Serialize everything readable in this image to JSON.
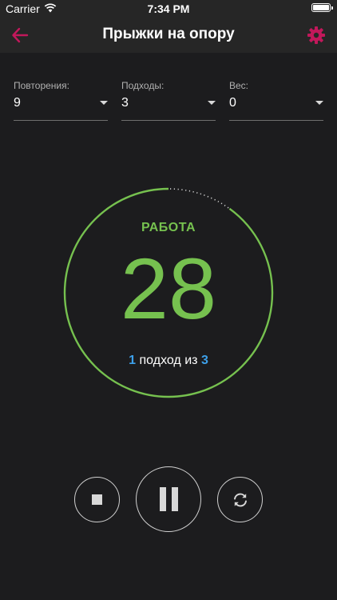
{
  "status_bar": {
    "carrier": "Carrier",
    "time": "7:34 PM",
    "battery_level": 1.0
  },
  "header": {
    "title": "Прыжки на опору",
    "back_icon": "arrow-left-icon",
    "settings_icon": "gear-icon"
  },
  "fields": [
    {
      "label": "Повторения:",
      "value": "9"
    },
    {
      "label": "Подходы:",
      "value": "3"
    },
    {
      "label": "Вес:",
      "value": "0"
    }
  ],
  "timer": {
    "phase": "РАБОТА",
    "seconds_left": "28",
    "progress": 0.9,
    "set_current": "1",
    "set_separator": "подход из",
    "set_total": "3"
  },
  "controls": {
    "stop_icon": "stop-icon",
    "pause_icon": "pause-icon",
    "reset_icon": "refresh-icon"
  },
  "colors": {
    "accent": "#c2185b",
    "timer_green": "#76c14f",
    "set_blue": "#3da0ea",
    "background": "#1c1c1e",
    "bar": "#262626"
  }
}
